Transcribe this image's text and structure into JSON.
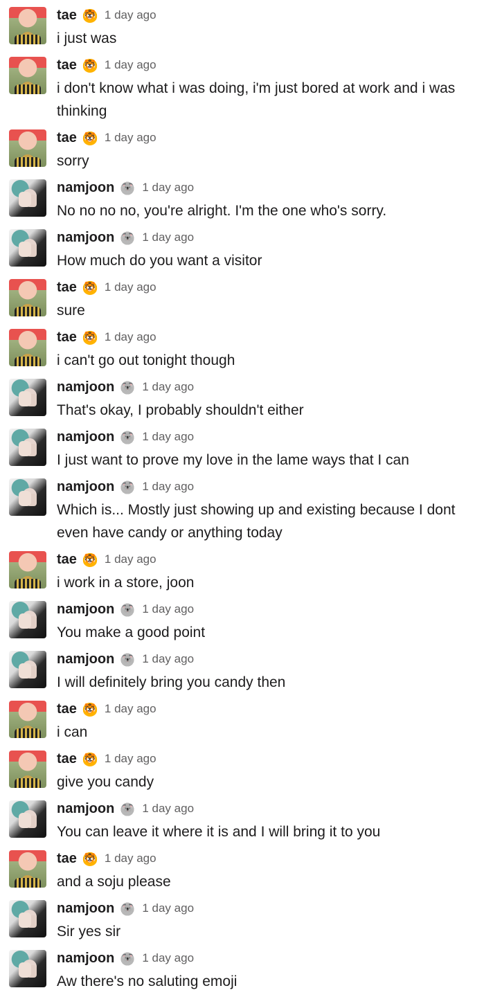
{
  "users": {
    "tae": {
      "name": "tae",
      "badge_icon": "tiger-face-icon",
      "badge_glyph": "🐯"
    },
    "namjoon": {
      "name": "namjoon",
      "badge_icon": "koala-face-icon",
      "badge_glyph": "🐨"
    }
  },
  "messages": [
    {
      "user": "tae",
      "name": "tae",
      "badge": "🐯",
      "time": "1 day ago",
      "text": "i just was"
    },
    {
      "user": "tae",
      "name": "tae",
      "badge": "🐯",
      "time": "1 day ago",
      "text": "i don't know what i was doing, i'm just bored at work and i was thinking"
    },
    {
      "user": "tae",
      "name": "tae",
      "badge": "🐯",
      "time": "1 day ago",
      "text": "sorry"
    },
    {
      "user": "namjoon",
      "name": "namjoon",
      "badge": "🐨",
      "time": "1 day ago",
      "text": "No no no no, you're alright. I'm the one who's sorry."
    },
    {
      "user": "namjoon",
      "name": "namjoon",
      "badge": "🐨",
      "time": "1 day ago",
      "text": "How much do you want a visitor"
    },
    {
      "user": "tae",
      "name": "tae",
      "badge": "🐯",
      "time": "1 day ago",
      "text": "sure"
    },
    {
      "user": "tae",
      "name": "tae",
      "badge": "🐯",
      "time": "1 day ago",
      "text": "i can't go out tonight though"
    },
    {
      "user": "namjoon",
      "name": "namjoon",
      "badge": "🐨",
      "time": "1 day ago",
      "text": "That's okay, I probably shouldn't either"
    },
    {
      "user": "namjoon",
      "name": "namjoon",
      "badge": "🐨",
      "time": "1 day ago",
      "text": "I just want to prove my love in the lame ways that I can"
    },
    {
      "user": "namjoon",
      "name": "namjoon",
      "badge": "🐨",
      "time": "1 day ago",
      "text": "Which is... Mostly just showing up and existing because I dont even have candy or anything today"
    },
    {
      "user": "tae",
      "name": "tae",
      "badge": "🐯",
      "time": "1 day ago",
      "text": "i work in a store, joon"
    },
    {
      "user": "namjoon",
      "name": "namjoon",
      "badge": "🐨",
      "time": "1 day ago",
      "text": "You make a good point"
    },
    {
      "user": "namjoon",
      "name": "namjoon",
      "badge": "🐨",
      "time": "1 day ago",
      "text": "I will definitely bring you candy then"
    },
    {
      "user": "tae",
      "name": "tae",
      "badge": "🐯",
      "time": "1 day ago",
      "text": "i can"
    },
    {
      "user": "tae",
      "name": "tae",
      "badge": "🐯",
      "time": "1 day ago",
      "text": "give you candy"
    },
    {
      "user": "namjoon",
      "name": "namjoon",
      "badge": "🐨",
      "time": "1 day ago",
      "text": "You can leave it where it is and I will bring it to you"
    },
    {
      "user": "tae",
      "name": "tae",
      "badge": "🐯",
      "time": "1 day ago",
      "text": "and a soju please"
    },
    {
      "user": "namjoon",
      "name": "namjoon",
      "badge": "🐨",
      "time": "1 day ago",
      "text": "Sir yes sir"
    },
    {
      "user": "namjoon",
      "name": "namjoon",
      "badge": "🐨",
      "time": "1 day ago",
      "text": "Aw there's no saluting emoji"
    }
  ]
}
